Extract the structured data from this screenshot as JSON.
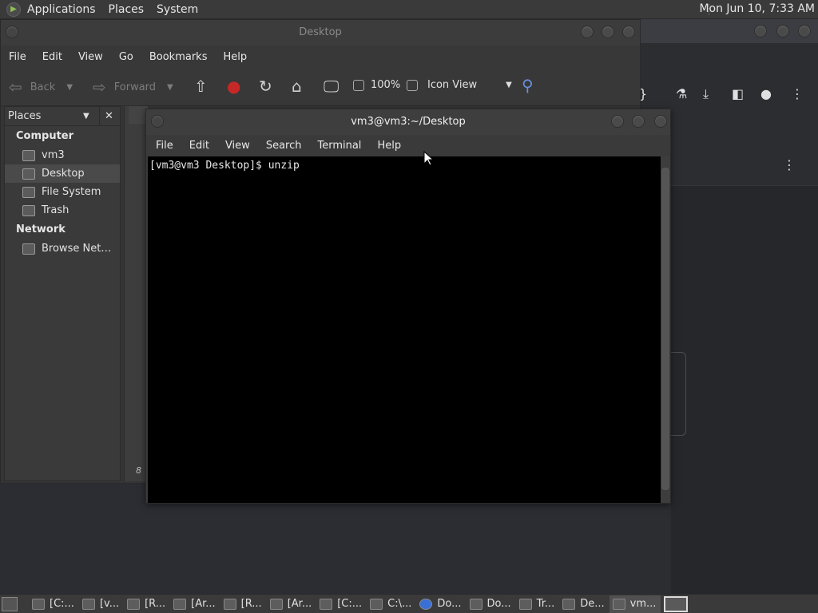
{
  "top_panel": {
    "menus": [
      "Applications",
      "Places",
      "System"
    ],
    "clock": "Mon Jun 10, 7:33 AM"
  },
  "file_manager": {
    "title": "Desktop",
    "menus": [
      "File",
      "Edit",
      "View",
      "Go",
      "Bookmarks",
      "Help"
    ],
    "toolbar": {
      "back": "Back",
      "forward": "Forward",
      "zoom": "100%",
      "view_mode": "Icon View"
    },
    "sidebar": {
      "selector": "Places",
      "sections": [
        {
          "heading": "Computer",
          "items": [
            "vm3",
            "Desktop",
            "File System",
            "Trash"
          ]
        },
        {
          "heading": "Network",
          "items": [
            "Browse Net…"
          ]
        }
      ],
      "selected": "Desktop"
    },
    "status_fragment": "8"
  },
  "terminal": {
    "title": "vm3@vm3:~/Desktop",
    "menus": [
      "File",
      "Edit",
      "View",
      "Search",
      "Terminal",
      "Help"
    ],
    "prompt_line": "[vm3@vm3 Desktop]$ unzip"
  },
  "taskbar": {
    "tasks": [
      "[C:...",
      "[v...",
      "[R...",
      "[Ar...",
      "[R...",
      "[Ar...",
      "[C:...",
      "C:\\...",
      "Do...",
      "Do...",
      "Tr...",
      "De...",
      "vm..."
    ],
    "active_task": "vm..."
  }
}
